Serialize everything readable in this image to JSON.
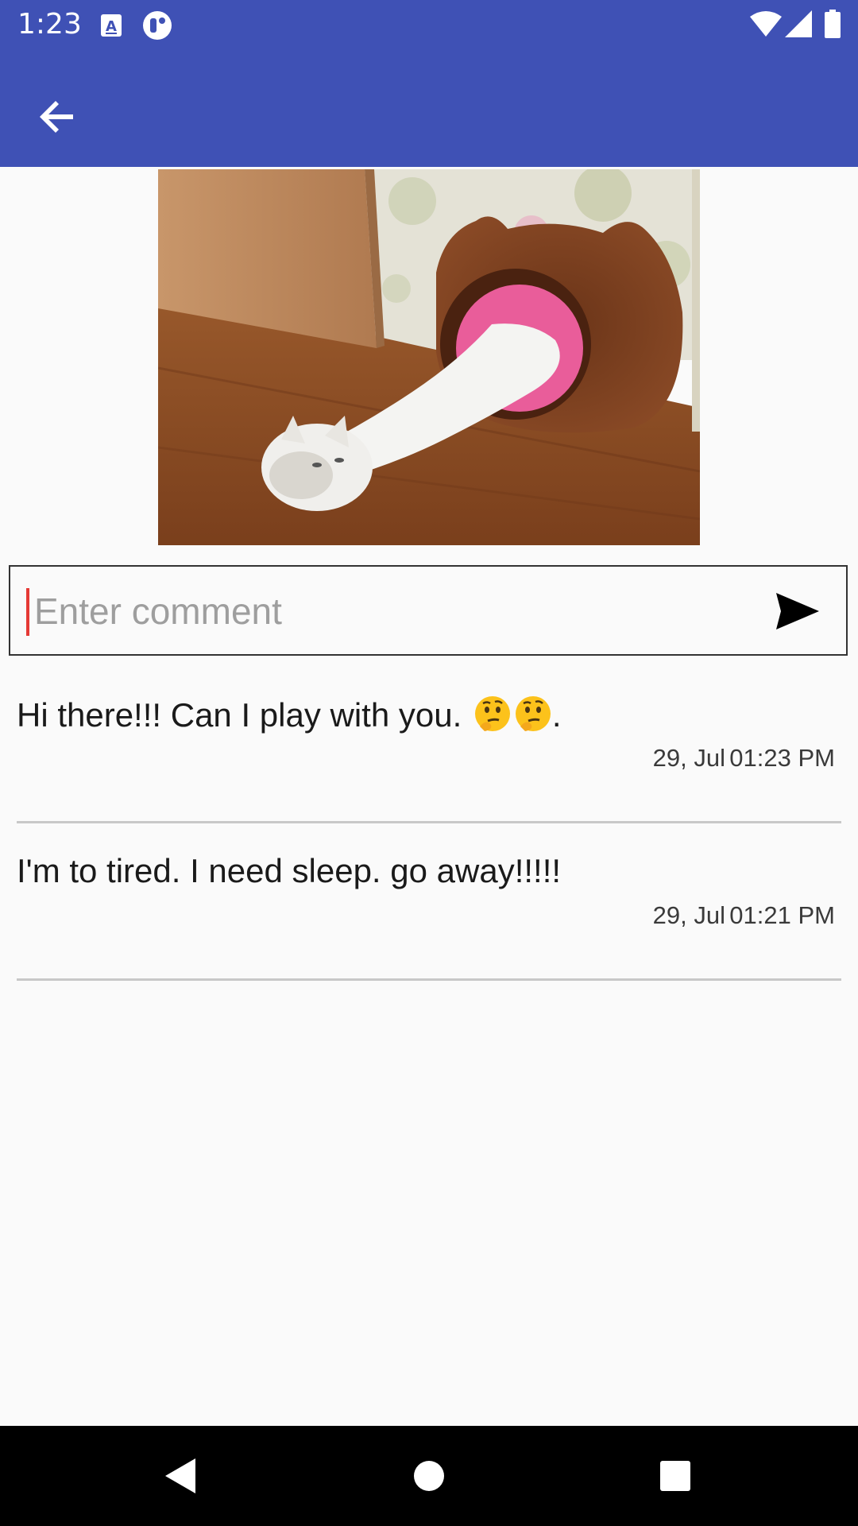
{
  "status_bar": {
    "time": "1:23",
    "left_icons": [
      "a-icon",
      "circle-app-icon"
    ],
    "right_icons": [
      "wifi-icon",
      "signal-icon",
      "battery-icon"
    ]
  },
  "app_bar": {
    "color": "#3f51b5",
    "back_icon": "arrow-back-icon"
  },
  "photo": {
    "description_icon": "cat-photo"
  },
  "comment_input": {
    "placeholder": "Enter comment",
    "value": "",
    "send_icon": "send-icon"
  },
  "comments": [
    {
      "text": "Hi there!!! Can I play with you. ",
      "emoji": "🤔🤔",
      "suffix": ".",
      "date": "29, Jul",
      "time": "01:23 PM"
    },
    {
      "text": "I'm to tired. I need sleep. go away!!!!!",
      "date": "29, Jul",
      "time": "01:21 PM"
    }
  ],
  "nav_bar": {
    "icons": [
      "back-triangle-icon",
      "home-circle-icon",
      "recents-square-icon"
    ]
  }
}
